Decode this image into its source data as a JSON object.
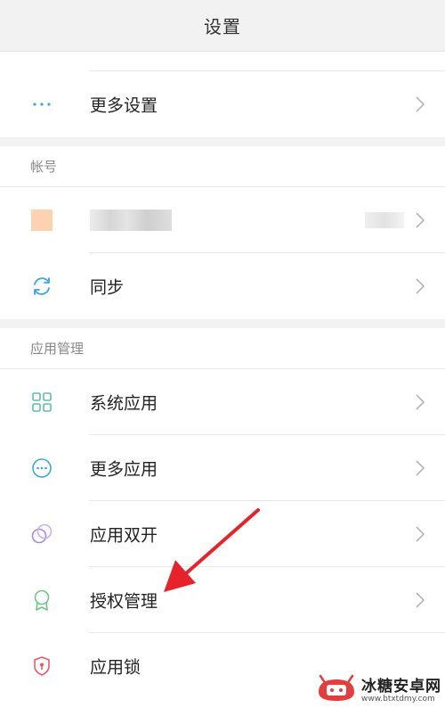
{
  "header": {
    "title": "设置"
  },
  "rows_top": [
    {
      "label": "更多设置",
      "icon": "more-dots-icon"
    }
  ],
  "account_section": {
    "title": "帐号",
    "sync_label": "同步"
  },
  "app_section": {
    "title": "应用管理",
    "items": [
      {
        "label": "系统应用",
        "icon": "grid-icon"
      },
      {
        "label": "更多应用",
        "icon": "more-circle-icon"
      },
      {
        "label": "应用双开",
        "icon": "dual-circles-icon"
      },
      {
        "label": "授权管理",
        "icon": "ribbon-badge-icon"
      },
      {
        "label": "应用锁",
        "icon": "shield-lock-icon"
      }
    ]
  },
  "watermark": {
    "title": "冰糖安卓网",
    "url": "www.btxtdmy.com"
  },
  "colors": {
    "header_bg": "#f2f2f2",
    "accent_blue": "#3aa8d8",
    "grid_green": "#5fc0a0",
    "purple": "#a58be0",
    "badge_green": "#6dc58a",
    "lock_red": "#e85a6a",
    "arrow_red": "#e8222a",
    "avatar": "#fcd2b0"
  }
}
